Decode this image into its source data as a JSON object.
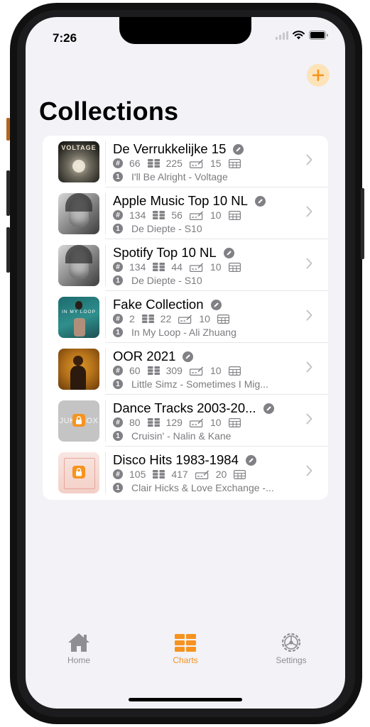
{
  "status_bar": {
    "time": "7:26"
  },
  "page_title": "Collections",
  "colors": {
    "accent": "#f7931e",
    "accent_light": "#fde3b8",
    "gray": "#808085"
  },
  "collections": [
    {
      "name": "De Verrukkelijke 15",
      "count": "66",
      "tracks": "225",
      "size": "15",
      "top_badge": "1",
      "top_item": "I'll Be Alright - Voltage",
      "thumb_text": "VOLTAGE"
    },
    {
      "name": "Apple Music Top 10 NL",
      "count": "134",
      "tracks": "56",
      "size": "10",
      "top_badge": "1",
      "top_item": "De Diepte - S10"
    },
    {
      "name": "Spotify Top 10 NL",
      "count": "134",
      "tracks": "44",
      "size": "10",
      "top_badge": "1",
      "top_item": "De Diepte - S10"
    },
    {
      "name": "Fake Collection",
      "count": "2",
      "tracks": "22",
      "size": "10",
      "top_badge": "1",
      "top_item": "In My Loop - Ali Zhuang",
      "thumb_text": "IN MY LOOP"
    },
    {
      "name": "OOR 2021",
      "count": "60",
      "tracks": "309",
      "size": "10",
      "top_badge": "1",
      "top_item": "Little Simz - Sometimes I Mig..."
    },
    {
      "name": "Dance Tracks 2003-20...",
      "count": "80",
      "tracks": "129",
      "size": "10",
      "top_badge": "1",
      "top_item": "Cruisin' - Nalin & Kane",
      "thumb_text": "JUKEBOX"
    },
    {
      "name": "Disco Hits 1983-1984",
      "count": "105",
      "tracks": "417",
      "size": "20",
      "top_badge": "1",
      "top_item": "Clair Hicks & Love Exchange -..."
    }
  ],
  "tabbar": {
    "home": "Home",
    "charts": "Charts",
    "settings": "Settings",
    "active": "charts"
  }
}
